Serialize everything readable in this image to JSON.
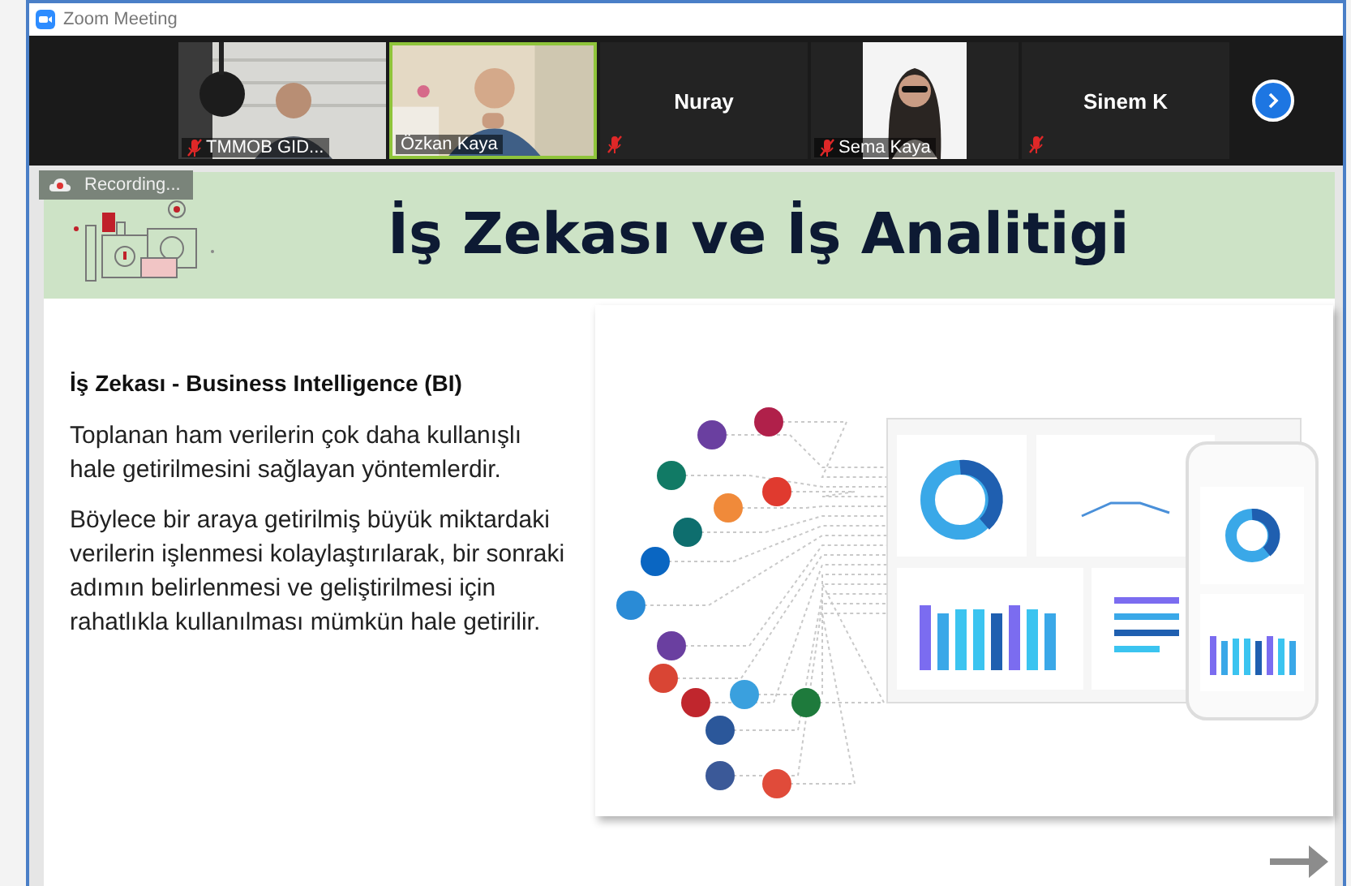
{
  "window": {
    "title": "Zoom Meeting"
  },
  "participants": [
    {
      "name": "TMMOB GID...",
      "kind": "video",
      "muted": true,
      "speaking": false
    },
    {
      "name": "Özkan Kaya",
      "kind": "video",
      "muted": false,
      "speaking": true
    },
    {
      "name": "Nuray",
      "kind": "name",
      "muted": true,
      "speaking": false
    },
    {
      "name": "Sema Kaya",
      "muted": true,
      "speaking": false
    },
    {
      "name": "Sinem K",
      "kind": "name",
      "muted": true,
      "speaking": false
    }
  ],
  "recording": {
    "label": "Recording..."
  },
  "slide": {
    "title": "İş Zekası ve İş Analitigi",
    "subtitle": "İş Zekası - Business Intelligence (BI)",
    "paragraphs": [
      "Toplanan ham verilerin çok daha kullanışlı hale getirilmesini sağlayan yöntemlerdir.",
      "Böylece bir araya getirilmiş büyük miktardaki verilerin işlenmesi kolaylaştırılarak, bir sonraki adımın belirlenmesi ve geliştirilmesi için rahatlıkla kullanılması mümkün hale getirilir."
    ]
  }
}
